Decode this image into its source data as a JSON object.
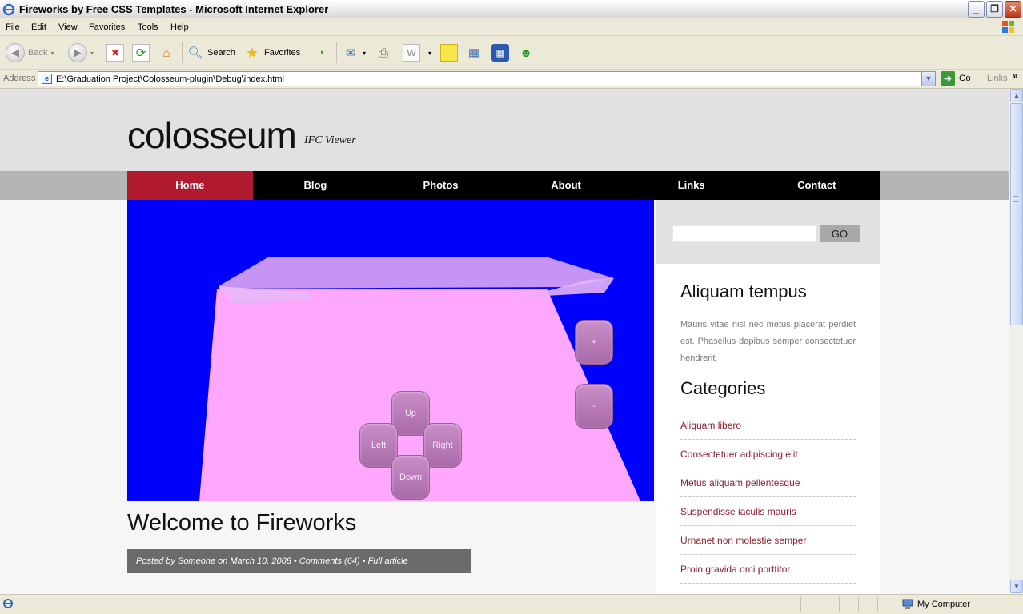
{
  "window": {
    "title": "Fireworks by Free CSS Templates - Microsoft Internet Explorer",
    "minimize": "_",
    "restore": "❐",
    "close": "✕"
  },
  "menu": [
    "File",
    "Edit",
    "View",
    "Favorites",
    "Tools",
    "Help"
  ],
  "toolbar": {
    "back": "Back",
    "search": "Search",
    "favorites": "Favorites"
  },
  "address": {
    "label": "Address",
    "url": "E:\\Graduation Project\\Colosseum-plugin\\Debug\\index.html",
    "go": "Go",
    "links": "Links"
  },
  "site": {
    "logo": "colosseum",
    "tagline": "IFC Viewer",
    "nav": [
      "Home",
      "Blog",
      "Photos",
      "About",
      "Links",
      "Contact"
    ],
    "active_nav": "Home",
    "viewer_controls": {
      "zoom_in": "+",
      "zoom_out": "-",
      "up": "Up",
      "left": "Left",
      "right": "Right",
      "down": "Down"
    },
    "post_title": "Welcome to Fireworks",
    "post_meta": "Posted by Someone on March 10, 2008  •  Comments (64)  •  Full article",
    "search_go": "GO",
    "sidebar_heading_1": "Aliquam tempus",
    "sidebar_text": "Mauris vitae nisl nec metus placerat perdiet est. Phasellus dapibus semper consectetuer hendrerit.",
    "sidebar_heading_2": "Categories",
    "categories": [
      "Aliquam libero",
      "Consectetuer adipiscing elit",
      "Metus aliquam pellentesque",
      "Suspendisse iaculis mauris",
      "Urnanet non molestie semper",
      "Proin gravida orci porttitor"
    ],
    "colors": {
      "accent": "#b11a2e",
      "viewer_bg": "#0000fd",
      "model": "#ffa6fd",
      "nav_bg": "#000000",
      "link": "#8e1e2e"
    }
  },
  "status": {
    "zone": "My Computer"
  }
}
